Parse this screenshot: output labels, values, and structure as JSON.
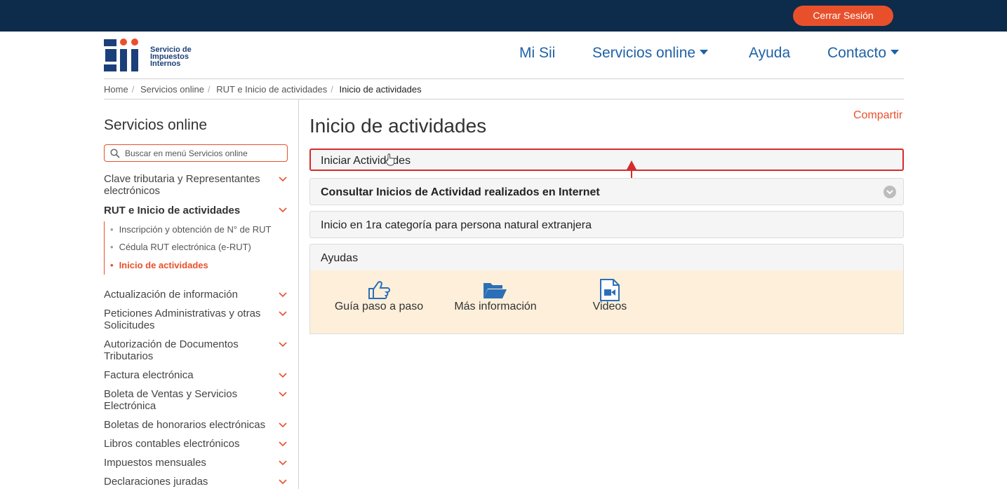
{
  "header": {
    "logout_label": "Cerrar Sesión",
    "logo_text": [
      "Servicio de",
      "Impuestos",
      "Internos"
    ]
  },
  "nav": {
    "items": [
      {
        "label": "Mi Sii"
      },
      {
        "label": "Servicios online",
        "dropdown": true
      },
      {
        "label": "Ayuda"
      },
      {
        "label": "Contacto",
        "dropdown": true
      }
    ]
  },
  "breadcrumb": [
    "Home",
    "Servicios online",
    "RUT e Inicio de actividades",
    "Inicio de actividades"
  ],
  "sidebar": {
    "title": "Servicios online",
    "search_placeholder": "Buscar en menú Servicios online",
    "items": [
      {
        "label": "Clave tributaria y Representantes electrónicos"
      },
      {
        "label": "RUT e Inicio de actividades",
        "expanded": true
      },
      {
        "label": "Actualización de información"
      },
      {
        "label": "Peticiones Administrativas y otras Solicitudes"
      },
      {
        "label": "Autorización de Documentos Tributarios"
      },
      {
        "label": "Factura electrónica"
      },
      {
        "label": "Boleta de Ventas y Servicios Electrónica"
      },
      {
        "label": "Boletas de honorarios electrónicas"
      },
      {
        "label": "Libros contables electrónicos"
      },
      {
        "label": "Impuestos mensuales"
      },
      {
        "label": "Declaraciones juradas"
      }
    ],
    "subitems": [
      {
        "label": "Inscripción y obtención de N° de RUT"
      },
      {
        "label": "Cédula RUT electrónica (e-RUT)"
      },
      {
        "label": "Inicio de actividades",
        "active": true
      }
    ]
  },
  "main": {
    "share_label": "Compartir",
    "title": "Inicio de actividades",
    "panels": [
      {
        "label": "Iniciar Actividades"
      },
      {
        "label": "Consultar Inicios de Actividad realizados en Internet"
      },
      {
        "label": "Inicio en 1ra categoría para persona natural extranjera"
      },
      {
        "label": "Ayudas"
      }
    ],
    "help_items": [
      {
        "label": "Guía paso a paso",
        "icon": "thumbs-up-icon"
      },
      {
        "label": "Más información",
        "icon": "folder-open-icon"
      },
      {
        "label": "Videos",
        "icon": "video-file-icon"
      }
    ]
  },
  "colors": {
    "topbar": "#0d2b4a",
    "accent": "#e8502c",
    "link": "#1f62a7",
    "highlight": "#d62b2b",
    "help_bg": "#fdefd9"
  }
}
